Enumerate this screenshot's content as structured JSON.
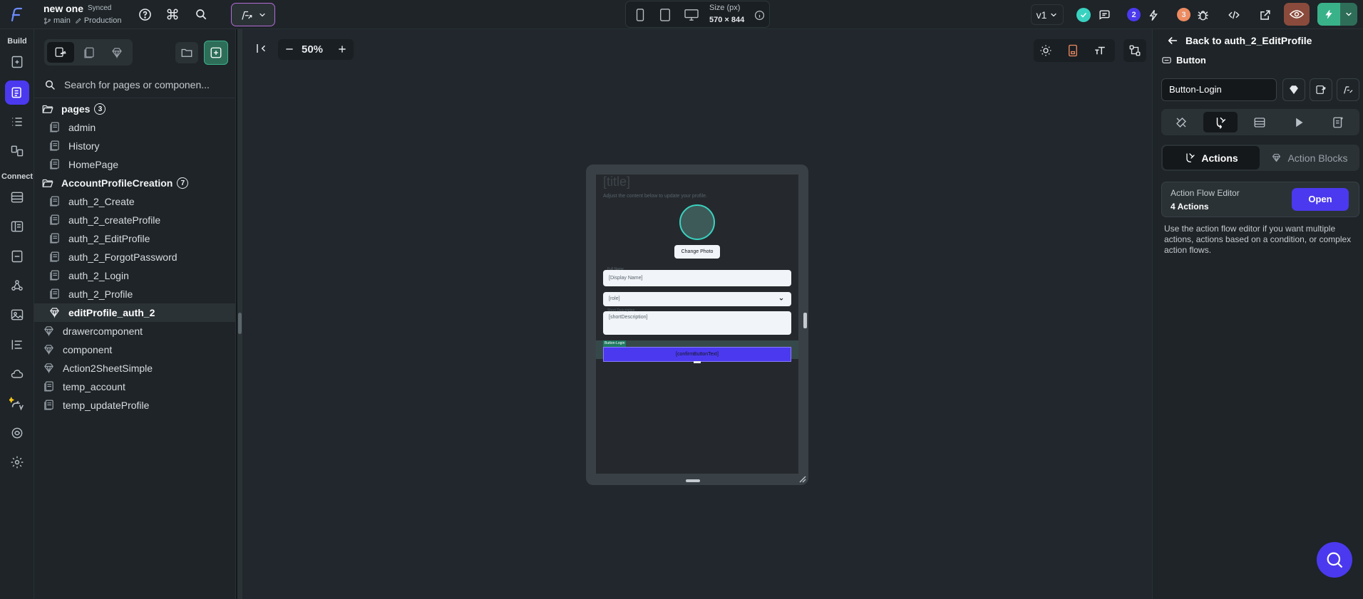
{
  "top": {
    "project_name": "new one",
    "sync_status": "Synced",
    "branch": "main",
    "environment": "Production",
    "size_label": "Size (px)",
    "size_value": "570 × 844",
    "version": "v1",
    "badge_count_1": "2",
    "badge_count_2": "3"
  },
  "rail": {
    "build_label": "Build",
    "connect_label": "Connect"
  },
  "left": {
    "search_placeholder": "Search for pages or componen...",
    "folders": [
      {
        "name": "pages",
        "count": "3"
      },
      {
        "name": "AccountProfileCreation",
        "count": "7"
      }
    ],
    "pages_items": [
      "admin",
      "History",
      "HomePage"
    ],
    "account_items": [
      "auth_2_Create",
      "auth_2_createProfile",
      "auth_2_EditProfile",
      "auth_2_ForgotPassword",
      "auth_2_Login",
      "auth_2_Profile",
      "editProfile_auth_2"
    ],
    "root_items": [
      "drawercomponent",
      "component",
      "Action2SheetSimple",
      "temp_account",
      "temp_updateProfile"
    ]
  },
  "canvas": {
    "zoom": "50%",
    "preview": {
      "title": "[title]",
      "subtitle": "Adjust the content below to update your profile.",
      "change_photo": "Change Photo",
      "display_name_label": "Full Name",
      "display_name": "[Display Name]",
      "role": "[role]",
      "short_desc_label": "Short Description",
      "short_desc": "[shortDescription]",
      "selected_tag": "Button-Login",
      "confirm_button": "[confirmButtonText]"
    }
  },
  "right": {
    "back_label": "Back to auth_2_EditProfile",
    "widget_type": "Button",
    "widget_name": "Button-Login",
    "tab_actions": "Actions",
    "tab_action_blocks": "Action Blocks",
    "flow_editor_title": "Action Flow Editor",
    "flow_editor_count": "4 Actions",
    "open_button": "Open",
    "help_text": "Use the action flow editor if you want multiple actions, actions based on a condition, or complex action flows."
  },
  "colors": {
    "accent": "#4b39ef",
    "background": "#14181b",
    "panel": "#1e2428",
    "canvas": "#21272c",
    "success": "#39d2c0",
    "warning": "#ee8b60"
  }
}
